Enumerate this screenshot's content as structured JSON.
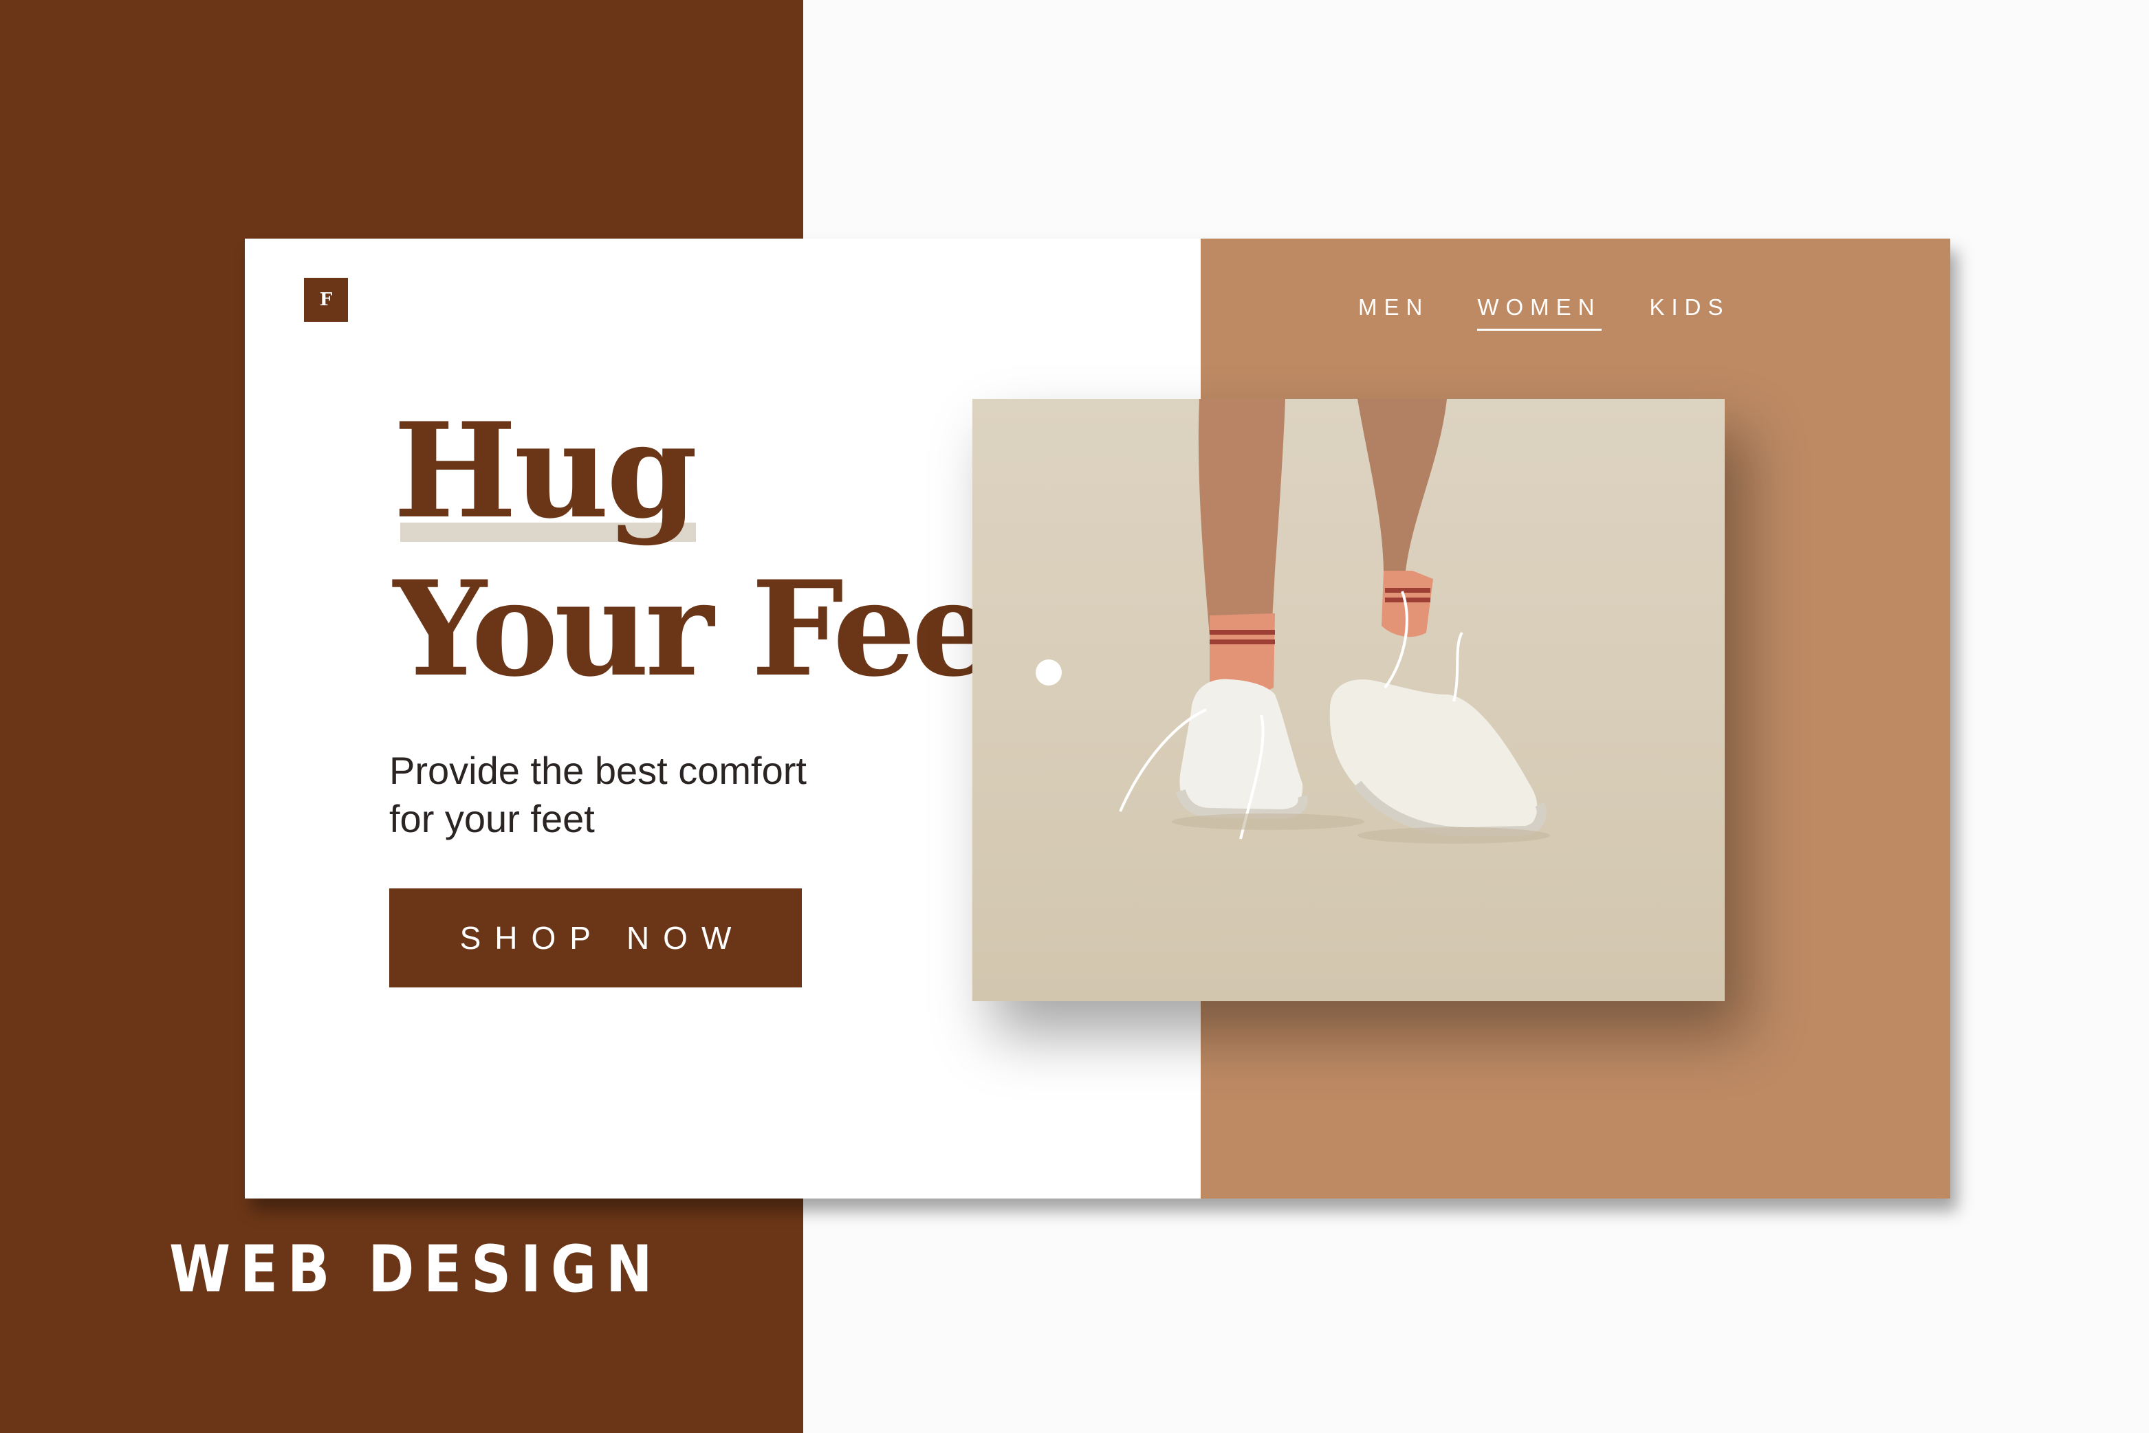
{
  "brand": {
    "logo_letter": "F"
  },
  "nav": {
    "items": [
      {
        "label": "MEN",
        "active": false
      },
      {
        "label": "WOMEN",
        "active": true
      },
      {
        "label": "KIDS",
        "active": false
      }
    ]
  },
  "hero": {
    "line1": "Hug",
    "line2": "Your Feet",
    "subtext_line1": "Provide the best comfort",
    "subtext_line2": "for your feet",
    "cta_label": "SHOP NOW"
  },
  "footer": {
    "label": "WEB DESIGN"
  },
  "colors": {
    "primary_brown": "#6b3617",
    "tan": "#bd8a64",
    "highlight": "#ddd6cb",
    "background": "#fbfbfb"
  },
  "photo": {
    "description_icon": "sneakers-photo"
  }
}
